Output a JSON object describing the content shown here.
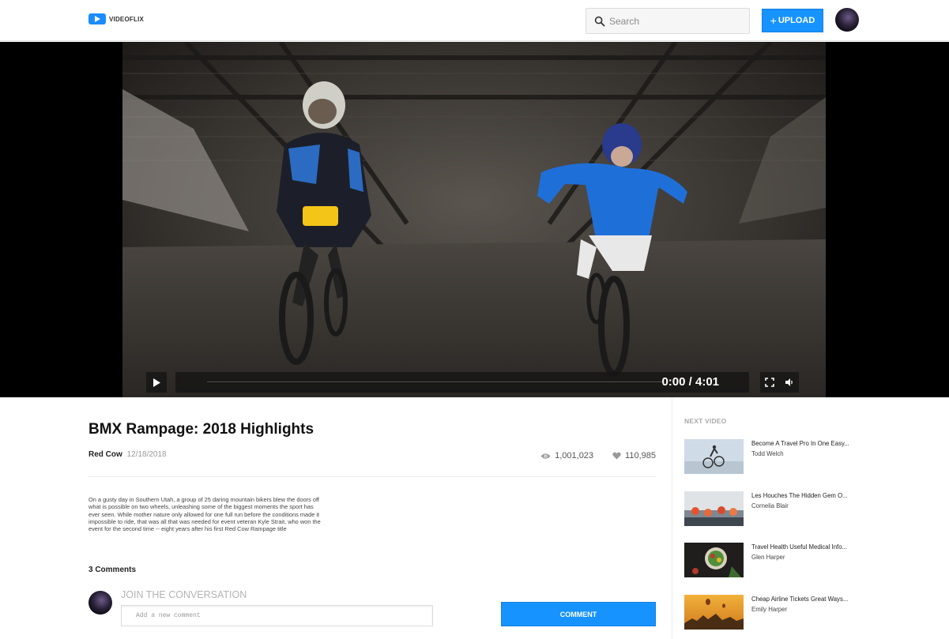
{
  "app": {
    "name": "VIDEOFLIX"
  },
  "header": {
    "search_placeholder": "Search",
    "upload_plus": "+",
    "upload_label": "UPLOAD"
  },
  "player": {
    "time": "0:00 / 4:01",
    "progress": 0
  },
  "video": {
    "title": "BMX Rampage: 2018 Highlights",
    "channel": "Red Cow",
    "date": "12/18/2018",
    "views": "1,001,023",
    "likes": "110,985",
    "description": "On a gusty day in Southern Utah, a group of 25 daring mountain bikers blew the doors off what is possible on two wheels, unleashing some of the biggest moments the sport has ever seen. While mother nature only allowed for one full run before the conditions made it impossible to ride, that was all that was needed for event veteran Kyle Strait, who won the event for the second time -- eight years after his first Red Cow Rampage title"
  },
  "comments": {
    "count_label": "3 Comments",
    "join_label": "JOIN THE CONVERSATION",
    "input_placeholder": "Add a new comment",
    "button_label": "COMMENT"
  },
  "sidebar": {
    "heading": "NEXT VIDEO",
    "items": [
      {
        "title": "Become A Travel Pro In One Easy...",
        "author": "Todd Welch"
      },
      {
        "title": "Les Houches The Hidden Gem O...",
        "author": "Cornelia Blair"
      },
      {
        "title": "Travel Health Useful Medical Info...",
        "author": "Glen Harper"
      },
      {
        "title": "Cheap Airline Tickets Great Ways...",
        "author": "Emily Harper"
      }
    ]
  },
  "colors": {
    "accent": "#1793ff"
  },
  "icons": {
    "logo": "play-logo-icon",
    "search": "search-icon",
    "play": "play-icon",
    "fullscreen": "fullscreen-icon",
    "volume": "volume-icon",
    "views": "eye-icon",
    "likes": "heart-icon"
  }
}
